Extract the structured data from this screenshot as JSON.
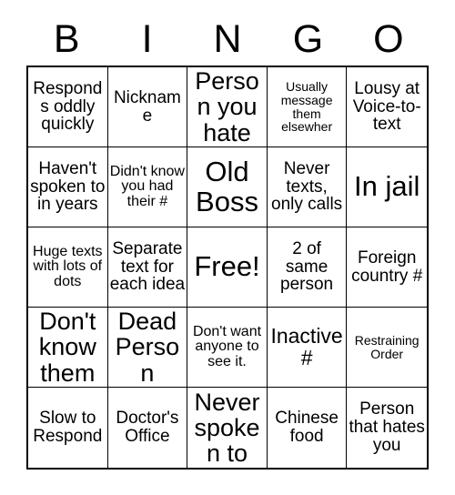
{
  "card": {
    "title_letters": [
      "B",
      "I",
      "N",
      "G",
      "O"
    ],
    "grid_size": 5,
    "cells": [
      {
        "text": "Responds oddly quickly",
        "size": "m",
        "free": false
      },
      {
        "text": "Nickname",
        "size": "m",
        "free": false
      },
      {
        "text": "Person you hate",
        "size": "xl",
        "free": false
      },
      {
        "text": "Usually message them elsewher",
        "size": "xs",
        "free": false
      },
      {
        "text": "Lousy at Voice-to-text",
        "size": "m",
        "free": false
      },
      {
        "text": "Haven't spoken to in years",
        "size": "m",
        "free": false
      },
      {
        "text": "Didn't know you had their #",
        "size": "s",
        "free": false
      },
      {
        "text": "Old Boss",
        "size": "xxl",
        "free": false
      },
      {
        "text": "Never texts, only calls",
        "size": "m",
        "free": false
      },
      {
        "text": "In jail",
        "size": "xxl",
        "free": false
      },
      {
        "text": "Huge texts with lots of dots",
        "size": "s",
        "free": false
      },
      {
        "text": "Separate text for each idea",
        "size": "m",
        "free": false
      },
      {
        "text": "Free!",
        "size": "xxl",
        "free": true
      },
      {
        "text": "2 of same person",
        "size": "m",
        "free": false
      },
      {
        "text": "Foreign country #",
        "size": "m",
        "free": false
      },
      {
        "text": "Don't know them",
        "size": "xl",
        "free": false
      },
      {
        "text": "Dead Person",
        "size": "xl",
        "free": false
      },
      {
        "text": "Don't want anyone to see it.",
        "size": "s",
        "free": false
      },
      {
        "text": "Inactive #",
        "size": "l",
        "free": false
      },
      {
        "text": "Restraining Order",
        "size": "xs",
        "free": false
      },
      {
        "text": "Slow to Respond",
        "size": "m",
        "free": false
      },
      {
        "text": "Doctor's Office",
        "size": "m",
        "free": false
      },
      {
        "text": "Never spoken to",
        "size": "xl",
        "free": false
      },
      {
        "text": "Chinese food",
        "size": "m",
        "free": false
      },
      {
        "text": "Person that hates you",
        "size": "m",
        "free": false
      }
    ]
  }
}
